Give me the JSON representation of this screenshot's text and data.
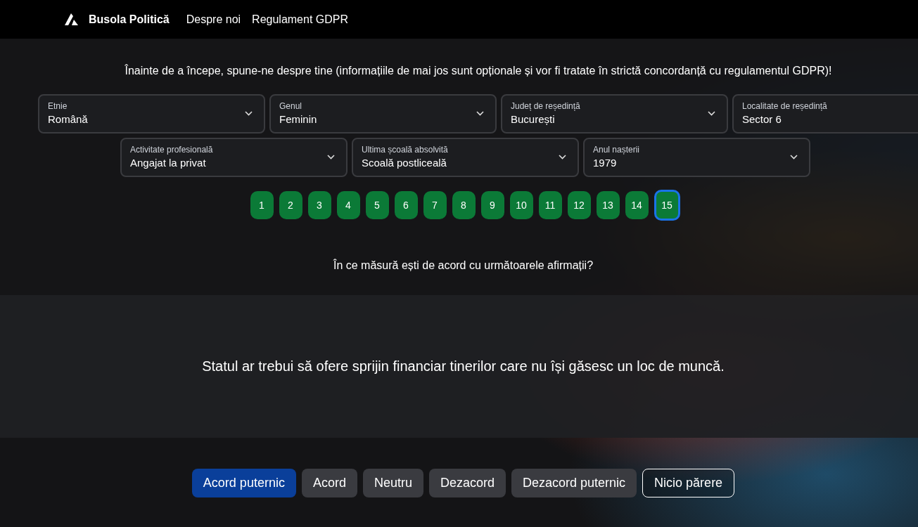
{
  "nav": {
    "brand": "Busola Politică",
    "links": [
      "Despre noi",
      "Regulament GDPR"
    ]
  },
  "intro": "Înainte de a începe, spune-ne despre tine (informațiile de mai jos sunt opționale și vor fi tratate în strictă concordanță cu regulamentul GDPR)!",
  "fields_row_1": [
    {
      "label": "Etnie",
      "value": "Română"
    },
    {
      "label": "Genul",
      "value": "Feminin"
    },
    {
      "label": "Județ de reședință",
      "value": "București"
    },
    {
      "label": "Localitate de reședință",
      "value": "Sector 6"
    }
  ],
  "fields_row_2": [
    {
      "label": "Activitate profesională",
      "value": "Angajat la privat"
    },
    {
      "label": "Ultima școală absolvită",
      "value": "Scoală postliceală"
    },
    {
      "label": "Anul nașterii",
      "value": "1979"
    }
  ],
  "questions": [
    {
      "label": "1",
      "selected": false
    },
    {
      "label": "2",
      "selected": false
    },
    {
      "label": "3",
      "selected": false
    },
    {
      "label": "4",
      "selected": false
    },
    {
      "label": "5",
      "selected": false
    },
    {
      "label": "6",
      "selected": false
    },
    {
      "label": "7",
      "selected": false
    },
    {
      "label": "8",
      "selected": false
    },
    {
      "label": "9",
      "selected": false
    },
    {
      "label": "10",
      "selected": false
    },
    {
      "label": "11",
      "selected": false
    },
    {
      "label": "12",
      "selected": false
    },
    {
      "label": "13",
      "selected": false
    },
    {
      "label": "14",
      "selected": false
    },
    {
      "label": "15",
      "selected": true
    }
  ],
  "prompt": "În ce măsură ești de acord cu următoarele afirmații?",
  "statement": "Statul ar trebui să ofere sprijin financiar tinerilor care nu își găsesc un loc de muncă.",
  "answers": [
    {
      "label": "Acord puternic",
      "kind": "filled",
      "selected": true
    },
    {
      "label": "Acord",
      "kind": "filled",
      "selected": false
    },
    {
      "label": "Neutru",
      "kind": "filled",
      "selected": false
    },
    {
      "label": "Dezacord",
      "kind": "filled",
      "selected": false
    },
    {
      "label": "Dezacord puternic",
      "kind": "filled",
      "selected": false
    },
    {
      "label": "Nicio părere",
      "kind": "outline",
      "selected": false
    }
  ]
}
